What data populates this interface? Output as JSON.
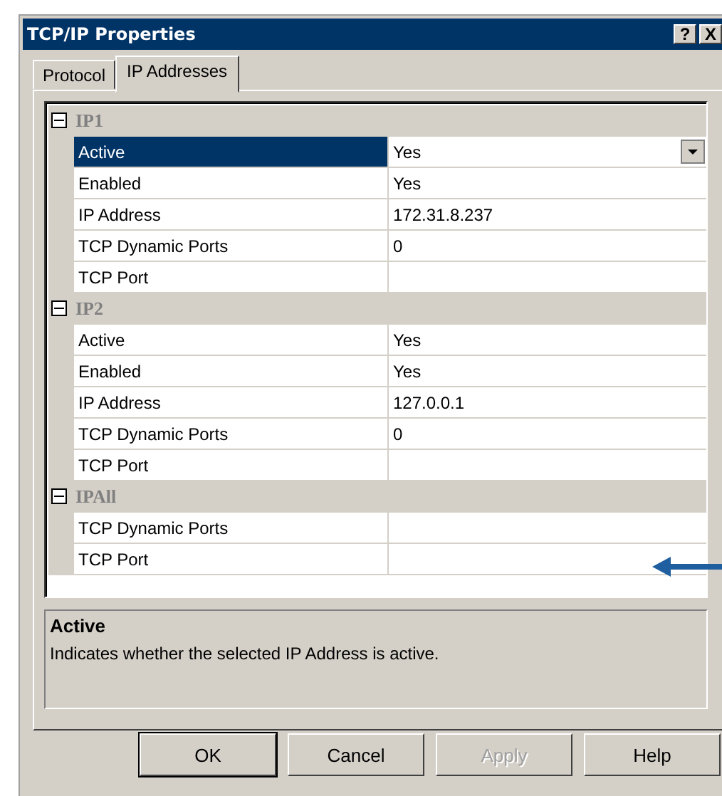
{
  "window": {
    "title": "TCP/IP Properties",
    "title_buttons": [
      "?",
      "X"
    ]
  },
  "tabs": [
    {
      "label": "Protocol",
      "selected": false
    },
    {
      "label": "IP Addresses",
      "selected": true
    }
  ],
  "groups": [
    {
      "name": "IP1",
      "expanded": true,
      "rows": [
        {
          "label": "Active",
          "value": "Yes",
          "selected": true
        },
        {
          "label": "Enabled",
          "value": "Yes",
          "selected": false
        },
        {
          "label": "IP Address",
          "value": "172.31.8.237",
          "selected": false
        },
        {
          "label": "TCP Dynamic Ports",
          "value": "0",
          "selected": false
        },
        {
          "label": "TCP Port",
          "selected": false
        }
      ]
    },
    {
      "name": "IP2",
      "expanded": true,
      "rows": [
        {
          "label": "Active",
          "value": "Yes",
          "selected": false
        },
        {
          "label": "Enabled",
          "value": "Yes",
          "selected": false
        },
        {
          "label": "IP Address",
          "value": "127.0.0.1",
          "selected": false
        },
        {
          "label": "TCP Dynamic Ports",
          "value": "0",
          "selected": false
        },
        {
          "label": "TCP Port",
          "selected": false
        }
      ]
    },
    {
      "name": "IPAll",
      "expanded": true,
      "rows": [
        {
          "label": "TCP Dynamic Ports",
          "selected": false
        },
        {
          "label": "TCP Port",
          "selected": false
        }
      ]
    }
  ],
  "description": {
    "title": "Active",
    "text": "Indicates whether the selected IP Address is active."
  },
  "buttons": [
    {
      "label": "OK",
      "default": true,
      "disabled": false
    },
    {
      "label": "Cancel",
      "default": false,
      "disabled": false
    },
    {
      "label": "Apply",
      "default": false,
      "disabled": true
    },
    {
      "label": "Help",
      "default": false,
      "disabled": false
    }
  ]
}
